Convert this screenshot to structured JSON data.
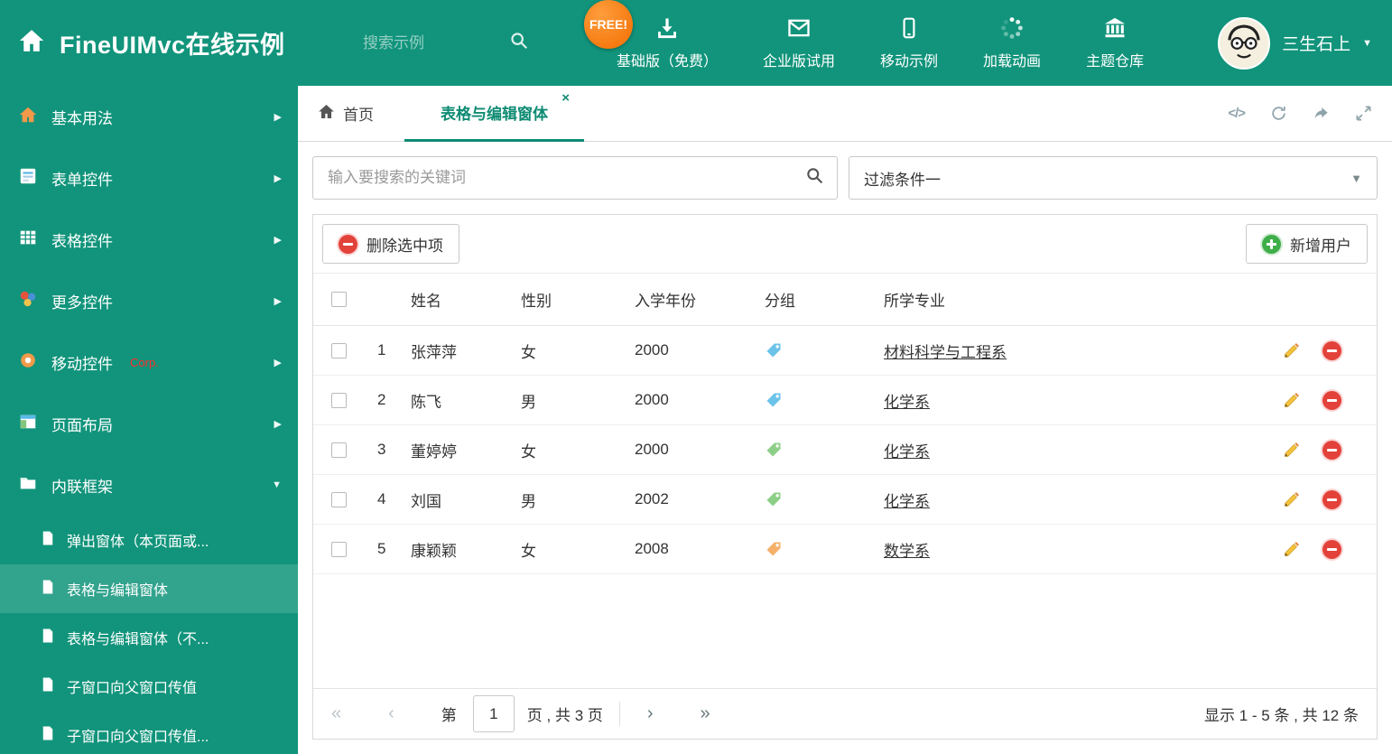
{
  "colors": {
    "primary_green": "#11947B",
    "accent_teal": "#0E8B73",
    "danger_red": "#E3423A",
    "success_green": "#3FAE49",
    "tag_blue": "#6CC3EA",
    "tag_green": "#8ECF87",
    "tag_orange": "#F5B06A"
  },
  "icons": {
    "chevron_right": "▶",
    "caret_down": "▼",
    "close": "×",
    "code": "</>"
  },
  "header": {
    "title": "FineUIMvc在线示例",
    "search_placeholder": "搜索示例",
    "free_badge": "FREE!",
    "menu": [
      {
        "label": "基础版（免费）"
      },
      {
        "label": "企业版试用"
      },
      {
        "label": "移动示例"
      },
      {
        "label": "加载动画"
      },
      {
        "label": "主题仓库"
      }
    ],
    "user": {
      "name": "三生石上"
    }
  },
  "sidebar": {
    "items": [
      {
        "label": "基本用法"
      },
      {
        "label": "表单控件"
      },
      {
        "label": "表格控件"
      },
      {
        "label": "更多控件"
      },
      {
        "label": "移动控件",
        "badge": "Corp."
      },
      {
        "label": "页面布局"
      },
      {
        "label": "内联框架",
        "expanded": true
      }
    ],
    "subitems": [
      {
        "label": "弹出窗体（本页面或..."
      },
      {
        "label": "表格与编辑窗体",
        "active": true
      },
      {
        "label": "表格与编辑窗体（不..."
      },
      {
        "label": "子窗口向父窗口传值"
      },
      {
        "label": "子窗口向父窗口传值..."
      }
    ]
  },
  "tabs": {
    "home": "首页",
    "active": "表格与编辑窗体"
  },
  "filters": {
    "search_placeholder": "输入要搜索的关键词",
    "dropdown_value": "过滤条件一"
  },
  "toolbar": {
    "delete_label": "删除选中项",
    "add_label": "新增用户"
  },
  "table": {
    "headers": {
      "name": "姓名",
      "gender": "性别",
      "year": "入学年份",
      "group": "分组",
      "major": "所学专业"
    },
    "rows": [
      {
        "num": "1",
        "name": "张萍萍",
        "gender": "女",
        "year": "2000",
        "tag": "blue",
        "major": "材料科学与工程系"
      },
      {
        "num": "2",
        "name": "陈飞",
        "gender": "男",
        "year": "2000",
        "tag": "blue",
        "major": "化学系"
      },
      {
        "num": "3",
        "name": "董婷婷",
        "gender": "女",
        "year": "2000",
        "tag": "green",
        "major": "化学系"
      },
      {
        "num": "4",
        "name": "刘国",
        "gender": "男",
        "year": "2002",
        "tag": "green",
        "major": "化学系"
      },
      {
        "num": "5",
        "name": "康颖颖",
        "gender": "女",
        "year": "2008",
        "tag": "orange",
        "major": "数学系"
      }
    ]
  },
  "pagination": {
    "first": "«",
    "prev": "‹",
    "next": "›",
    "last": "»",
    "page_prefix": "第",
    "page_value": "1",
    "page_suffix": "页 , 共 3 页",
    "summary": "显示 1 - 5 条 , 共 12 条"
  }
}
